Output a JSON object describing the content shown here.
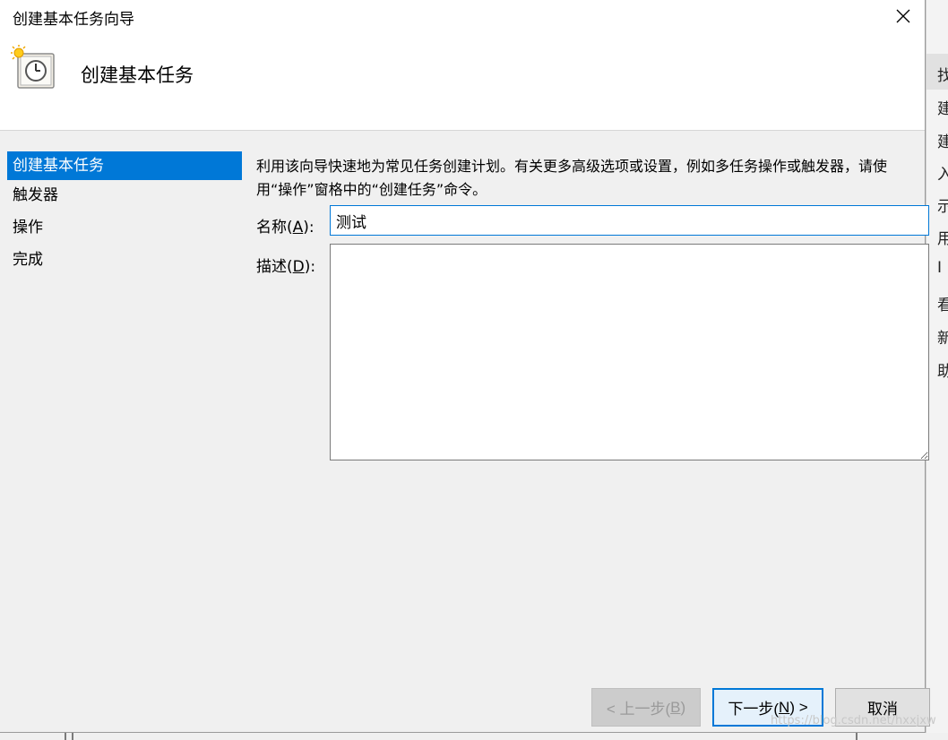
{
  "window": {
    "title": "创建基本任务向导"
  },
  "header": {
    "title": "创建基本任务",
    "icon": "clock-sun-icon"
  },
  "nav": {
    "items": [
      {
        "label": "创建基本任务",
        "active": true
      },
      {
        "label": "触发器",
        "active": false
      },
      {
        "label": "操作",
        "active": false
      },
      {
        "label": "完成",
        "active": false
      }
    ]
  },
  "main": {
    "description": "利用该向导快速地为常见任务创建计划。有关更多高级选项或设置，例如多任务操作或触发器，请使用“操作”窗格中的“创建任务”命令。",
    "name_label_pre": "名称(",
    "name_label_key": "A",
    "name_label_post": "):",
    "name_value": "测试",
    "desc_label_pre": "描述(",
    "desc_label_key": "D",
    "desc_label_post": "):",
    "desc_value": ""
  },
  "buttons": {
    "back_pre": "< 上一步(",
    "back_key": "B",
    "back_post": ")",
    "next_pre": "下一步(",
    "next_key": "N",
    "next_post": ") >",
    "cancel": "取消"
  },
  "background": {
    "side_chars": [
      "找",
      "建",
      "建",
      "入",
      "示",
      "用",
      "I",
      "看",
      "新",
      "助"
    ]
  },
  "watermark": "https://blog.csdn.net/hxxjxw"
}
